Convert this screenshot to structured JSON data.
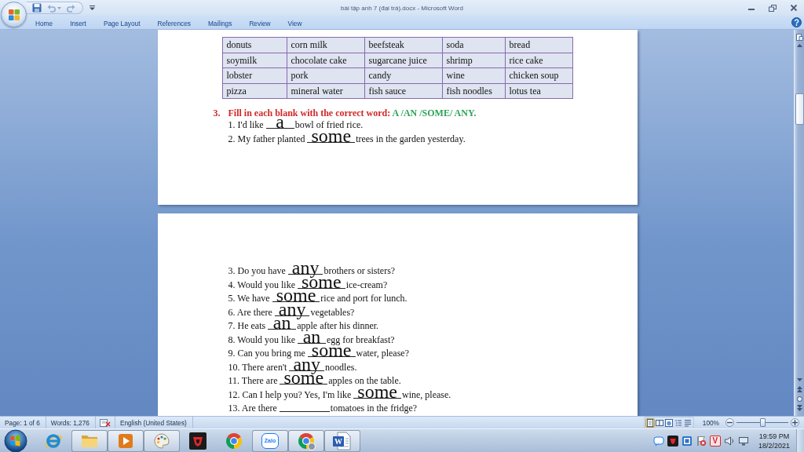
{
  "window": {
    "title": "bài tập anh 7 (đại trà).docx - Microsoft Word"
  },
  "quick_access": [
    {
      "kind": "save",
      "disabled": false
    },
    {
      "kind": "undo",
      "disabled": true
    },
    {
      "kind": "redo",
      "disabled": true
    }
  ],
  "ribbon_tabs": [
    {
      "label": "Home",
      "selected": false
    },
    {
      "label": "Insert",
      "selected": false
    },
    {
      "label": "Page Layout",
      "selected": false
    },
    {
      "label": "References",
      "selected": false
    },
    {
      "label": "Mailings",
      "selected": false
    },
    {
      "label": "Review",
      "selected": false
    },
    {
      "label": "View",
      "selected": false
    }
  ],
  "page_1": {
    "table": {
      "rows": [
        [
          "donuts",
          "corn milk",
          "beefsteak",
          "soda",
          "bread"
        ],
        [
          "soymilk",
          "chocolate cake",
          "sugarcane juice",
          "shrimp",
          "rice cake"
        ],
        [
          "lobster",
          "pork",
          "candy",
          "wine",
          "chicken soup"
        ],
        [
          "pizza",
          "mineral water",
          "fish sauce",
          "fish noodles",
          "lotus tea"
        ]
      ]
    },
    "exercise": {
      "number": "3.",
      "instruction": "Fill in each blank with the correct word:",
      "choices": "A /AN /SOME/ ANY."
    },
    "sentences": [
      {
        "before": "1. I'd like",
        "answer": "a",
        "after": "bowl of fried rice."
      },
      {
        "before": "2. My father planted",
        "answer": "some",
        "after": "trees in the garden yesterday."
      }
    ]
  },
  "page_2": {
    "sentences": [
      {
        "before": "3. Do you have",
        "answer": "any",
        "after": "brothers or sisters?"
      },
      {
        "before": "4. Would you like",
        "answer": "some",
        "after": "ice-cream?"
      },
      {
        "before": "5. We have",
        "answer": "some",
        "after": "rice and port for lunch."
      },
      {
        "before": "6. Are there",
        "answer": "any",
        "after": "vegetables?"
      },
      {
        "before": "7. He eats",
        "answer": "an",
        "after": "apple after his dinner."
      },
      {
        "before": "8. Would you like",
        "answer": "an",
        "after": "egg for breakfast?"
      },
      {
        "before": "9. Can you bring me",
        "answer": "some",
        "after": "water, please?"
      },
      {
        "before": "10. There aren't",
        "answer": "any",
        "after": "noodles."
      },
      {
        "before": "11. There are",
        "answer": "some",
        "after": "apples on the table."
      },
      {
        "before": "12. Can I help you? Yes, I'm like",
        "answer": "some",
        "after": "wine, please."
      },
      {
        "before": "13. Are there",
        "after": "tomatoes in the fridge?"
      }
    ]
  },
  "status_bar": {
    "page": "Page: 1 of 6",
    "words": "Words: 1,276",
    "language": "English (United States)",
    "view_buttons": [
      {
        "kind": "print",
        "selected": true
      },
      {
        "kind": "reading",
        "selected": false
      },
      {
        "kind": "web",
        "selected": false
      },
      {
        "kind": "outline",
        "selected": false
      },
      {
        "kind": "draft",
        "selected": false
      }
    ],
    "zoom": "100%",
    "zoom_slider": {
      "level": 0.5
    }
  },
  "taskbar": {
    "items": [
      {
        "kind": "ie",
        "running": false
      },
      {
        "kind": "folder",
        "running": true
      },
      {
        "kind": "media",
        "running": true
      },
      {
        "kind": "paint",
        "running": true
      },
      {
        "kind": "game",
        "running": false
      },
      {
        "kind": "chrome",
        "running": false
      },
      {
        "kind": "zalo",
        "running": true,
        "text": "Zalo"
      },
      {
        "kind": "chrome-profile",
        "running": true
      },
      {
        "kind": "word",
        "running": true,
        "text": "W"
      }
    ],
    "tray": {
      "icons": [
        {
          "kind": "chat"
        },
        {
          "kind": "emblem"
        },
        {
          "kind": "square"
        },
        {
          "kind": "flag"
        },
        {
          "kind": "letter",
          "text": "V"
        },
        {
          "kind": "speaker"
        },
        {
          "kind": "monitor"
        }
      ],
      "time": "19:59 PM",
      "date": "18/2/2021"
    }
  }
}
